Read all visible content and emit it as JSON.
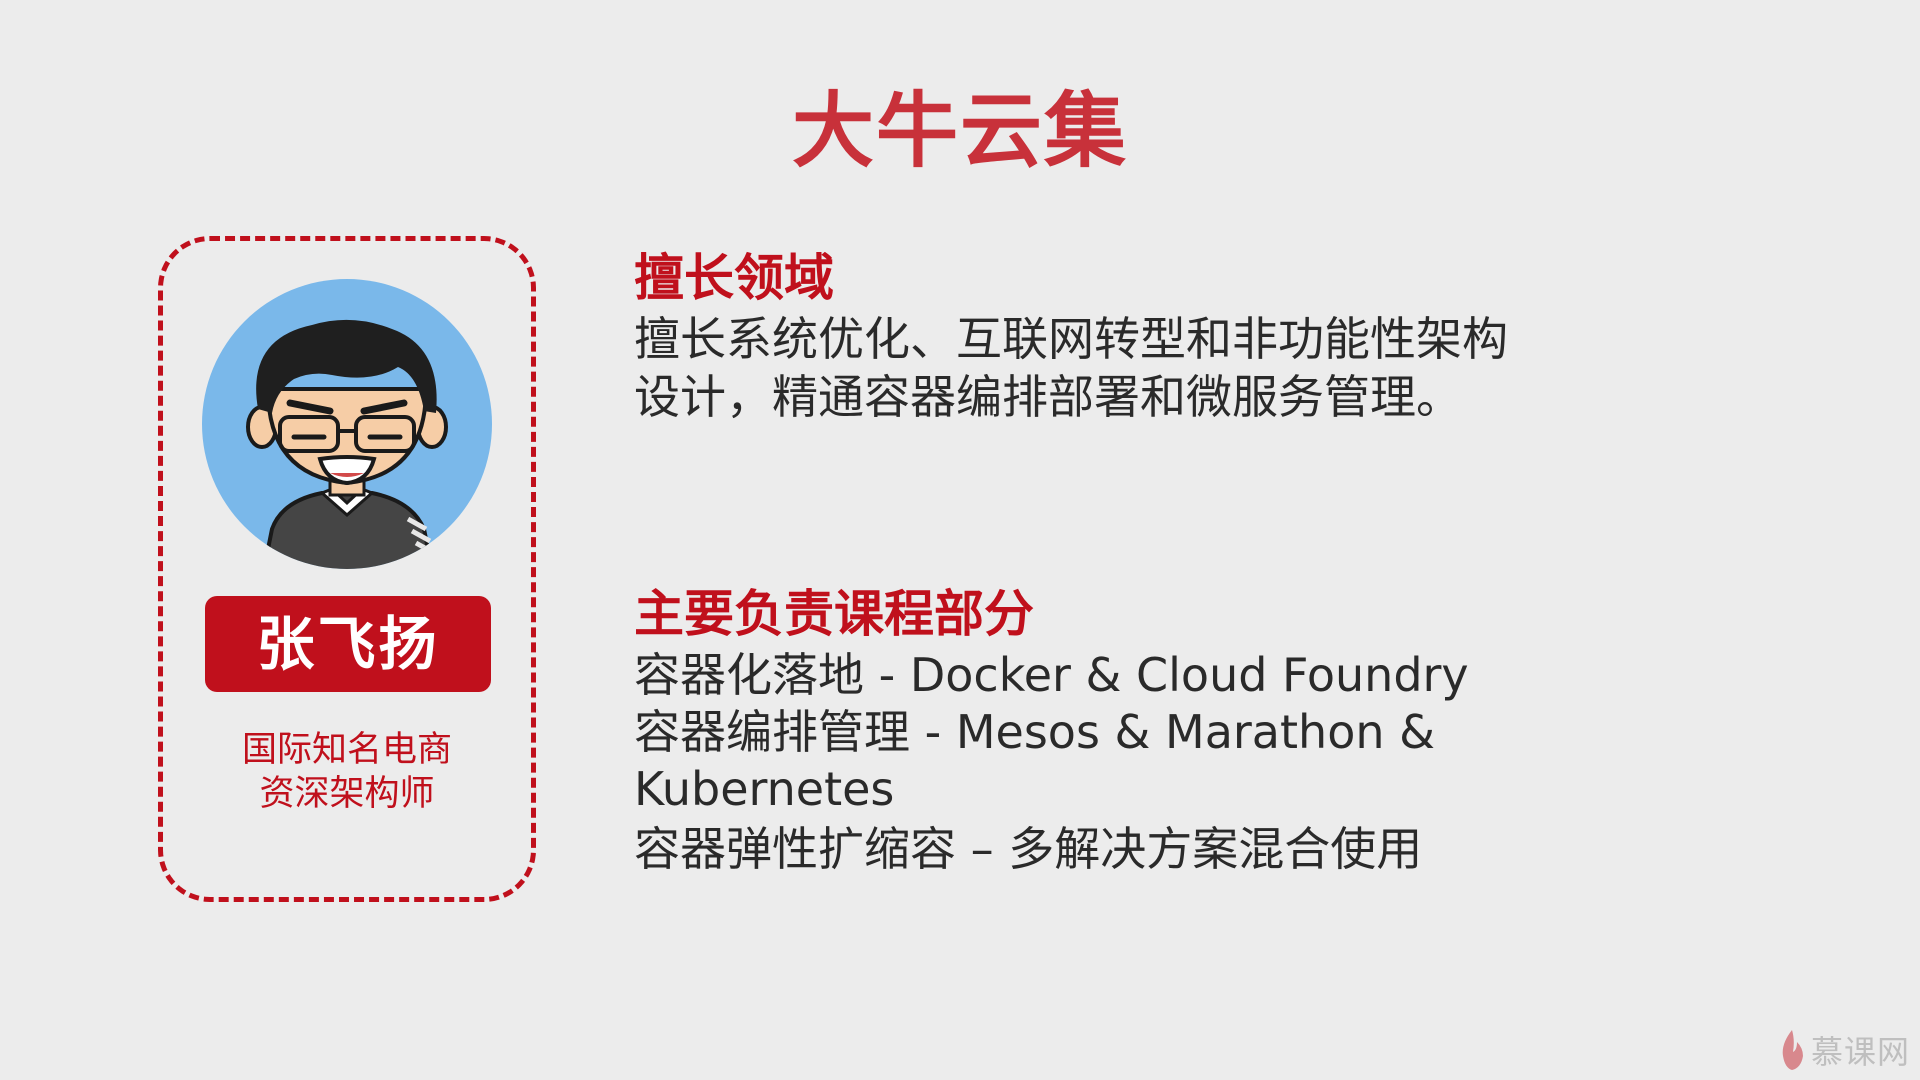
{
  "title": "大牛云集",
  "profile": {
    "name": "张飞扬",
    "subtitle_line1": "国际知名电商",
    "subtitle_line2": "资深架构师",
    "avatar_icon": "cartoon-avatar-icon"
  },
  "expertise": {
    "heading": "擅长领域",
    "lines": [
      "擅长系统优化、互联网转型和非功能性架构",
      "设计，精通容器编排部署和微服务管理。"
    ]
  },
  "courses": {
    "heading": "主要负责课程部分",
    "lines": [
      "容器化落地 - Docker & Cloud Foundry",
      "容器编排管理 - Mesos & Marathon &",
      "Kubernetes",
      "容器弹性扩缩容 – 多解决方案混合使用"
    ]
  },
  "watermark": {
    "text": "慕课网",
    "icon": "flame-logo-icon"
  },
  "colors": {
    "accent": "#c0101c",
    "title": "#c8313a",
    "background": "#ececec",
    "avatar_bg": "#7ab8ea"
  }
}
